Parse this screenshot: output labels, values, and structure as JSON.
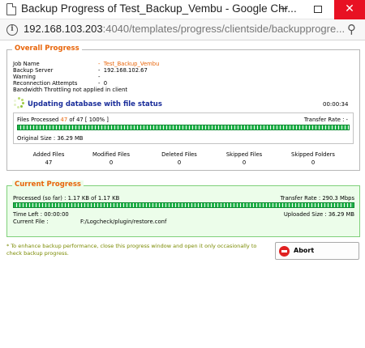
{
  "window": {
    "title": "Backup Progress of Test_Backup_Vembu - Google Chr...",
    "minimize_glyph": "−",
    "close_glyph": "✕",
    "info_glyph": "i",
    "zoom_glyph": "⚲"
  },
  "address": {
    "host": "192.168.103.203",
    "rest": ":4040/templates/progress/clientside/backupprogre..."
  },
  "overall": {
    "legend": "Overall Progress",
    "job_name_label": "Job Name",
    "job_name_value": "Test_Backup_Vembu",
    "backup_server_label": "Backup Server",
    "backup_server_value": "192.168.102.67",
    "warning_label": "Warning",
    "warning_value": "",
    "reconnection_label": "Reconnection Attempts",
    "reconnection_value": "0",
    "bandwidth_note": "Bandwidth Throttling not applied in client",
    "status": "Updating database with file status",
    "elapsed": "00:00:34",
    "files_processed_prefix": "Files Processed",
    "files_processed_done": "47",
    "files_processed_suffix": "of 47 [ 100% ]",
    "transfer_rate_label": "Transfer Rate :  -",
    "progress_fraction": 1.0,
    "original_size": "Original Size : 36.29 MB",
    "stats": {
      "headers": [
        "Added Files",
        "Modified Files",
        "Deleted Files",
        "Skipped Files",
        "Skipped Folders"
      ],
      "values": [
        "47",
        "0",
        "0",
        "0",
        "0"
      ]
    }
  },
  "current": {
    "legend": "Current Progress",
    "processed": "Processed (so far) : 1.17 KB  of  1.17 KB",
    "transfer_rate": "Transfer Rate : 290.3 Mbps",
    "progress_fraction": 1.0,
    "time_left": "Time Left : 00:00:00",
    "uploaded_size": "Uploaded Size : 36.29 MB",
    "current_file_label": "Current File :",
    "current_file_value": "F:/Logcheck/plugin/restore.conf"
  },
  "footer": {
    "note_line1": "* To enhance backup performance, close this progress window and open it only occasionally to",
    "note_line2": "check backup progress.",
    "abort_label": "Abort"
  },
  "colors": {
    "accent_orange": "#e8650a",
    "status_blue": "#1a2d9a",
    "progress_green": "#21b14a",
    "current_panel_bg": "#ecfdea",
    "abort_red": "#e02121"
  }
}
